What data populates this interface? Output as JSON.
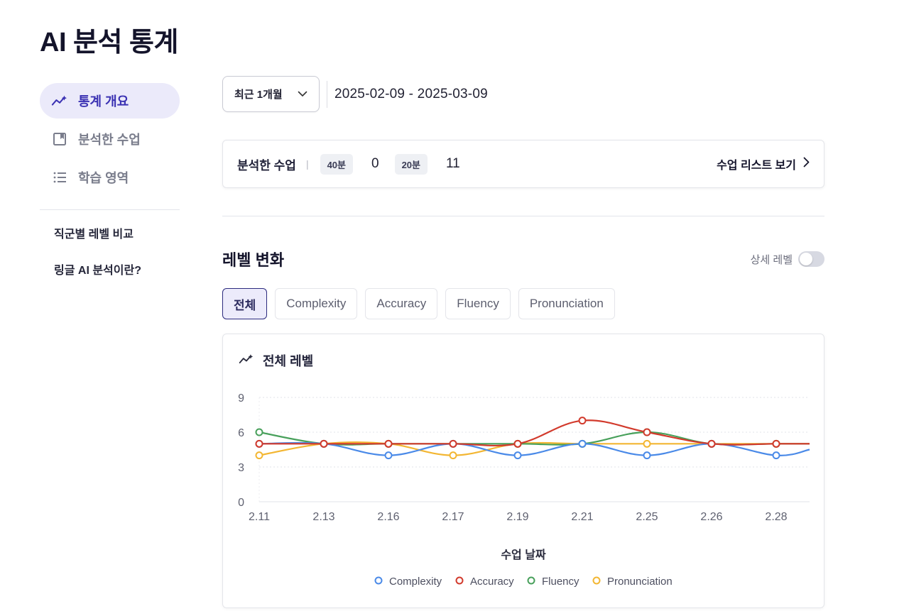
{
  "page": {
    "title": "AI 분석 통계"
  },
  "sidebar": {
    "items": [
      {
        "label": "통계 개요",
        "icon": "trend-chart-icon",
        "active": true
      },
      {
        "label": "분석한 수업",
        "icon": "bookmark-icon",
        "active": false
      },
      {
        "label": "학습 영역",
        "icon": "list-icon",
        "active": false
      }
    ],
    "links": [
      {
        "label": "직군별 레벨 비교"
      },
      {
        "label": "링글 AI 분석이란?"
      }
    ]
  },
  "filter": {
    "period_label": "최근 1개월",
    "date_range": "2025-02-09 - 2025-03-09"
  },
  "summary": {
    "title": "분석한 수업",
    "separator": "|",
    "badge_40": "40분",
    "count_40": "0",
    "badge_20": "20분",
    "count_20": "11",
    "link_label": "수업 리스트 보기"
  },
  "level": {
    "title": "레벨 변화",
    "detail_toggle_label": "상세 레벨",
    "detail_toggle_on": false,
    "tabs": [
      "전체",
      "Complexity",
      "Accuracy",
      "Fluency",
      "Pronunciation"
    ],
    "active_tab": "전체",
    "card_title": "전체 레벨"
  },
  "chart_data": {
    "type": "line",
    "xlabel": "수업 날짜",
    "ylabel": "",
    "ylim": [
      0,
      9
    ],
    "yticks": [
      0,
      3,
      6,
      9
    ],
    "grid": true,
    "legend_position": "bottom",
    "categories": [
      "2.11",
      "2.13",
      "2.16",
      "2.17",
      "2.19",
      "2.21",
      "2.25",
      "2.26",
      "2.28"
    ],
    "series": [
      {
        "name": "Complexity",
        "color": "#4a8ae8",
        "values": [
          5,
          5,
          4,
          5,
          4,
          5,
          4,
          5,
          4
        ],
        "tail": 4.5
      },
      {
        "name": "Accuracy",
        "color": "#d23a2c",
        "values": [
          5,
          5,
          5,
          5,
          5,
          7,
          6,
          5,
          5
        ],
        "tail": 5
      },
      {
        "name": "Fluency",
        "color": "#48a05b",
        "values": [
          6,
          5,
          5,
          5,
          5,
          5,
          6,
          5,
          5
        ],
        "tail": 5
      },
      {
        "name": "Pronunciation",
        "color": "#f3b632",
        "values": [
          4,
          5,
          5,
          4,
          5,
          5,
          5,
          5,
          5
        ],
        "tail": 5
      }
    ]
  }
}
